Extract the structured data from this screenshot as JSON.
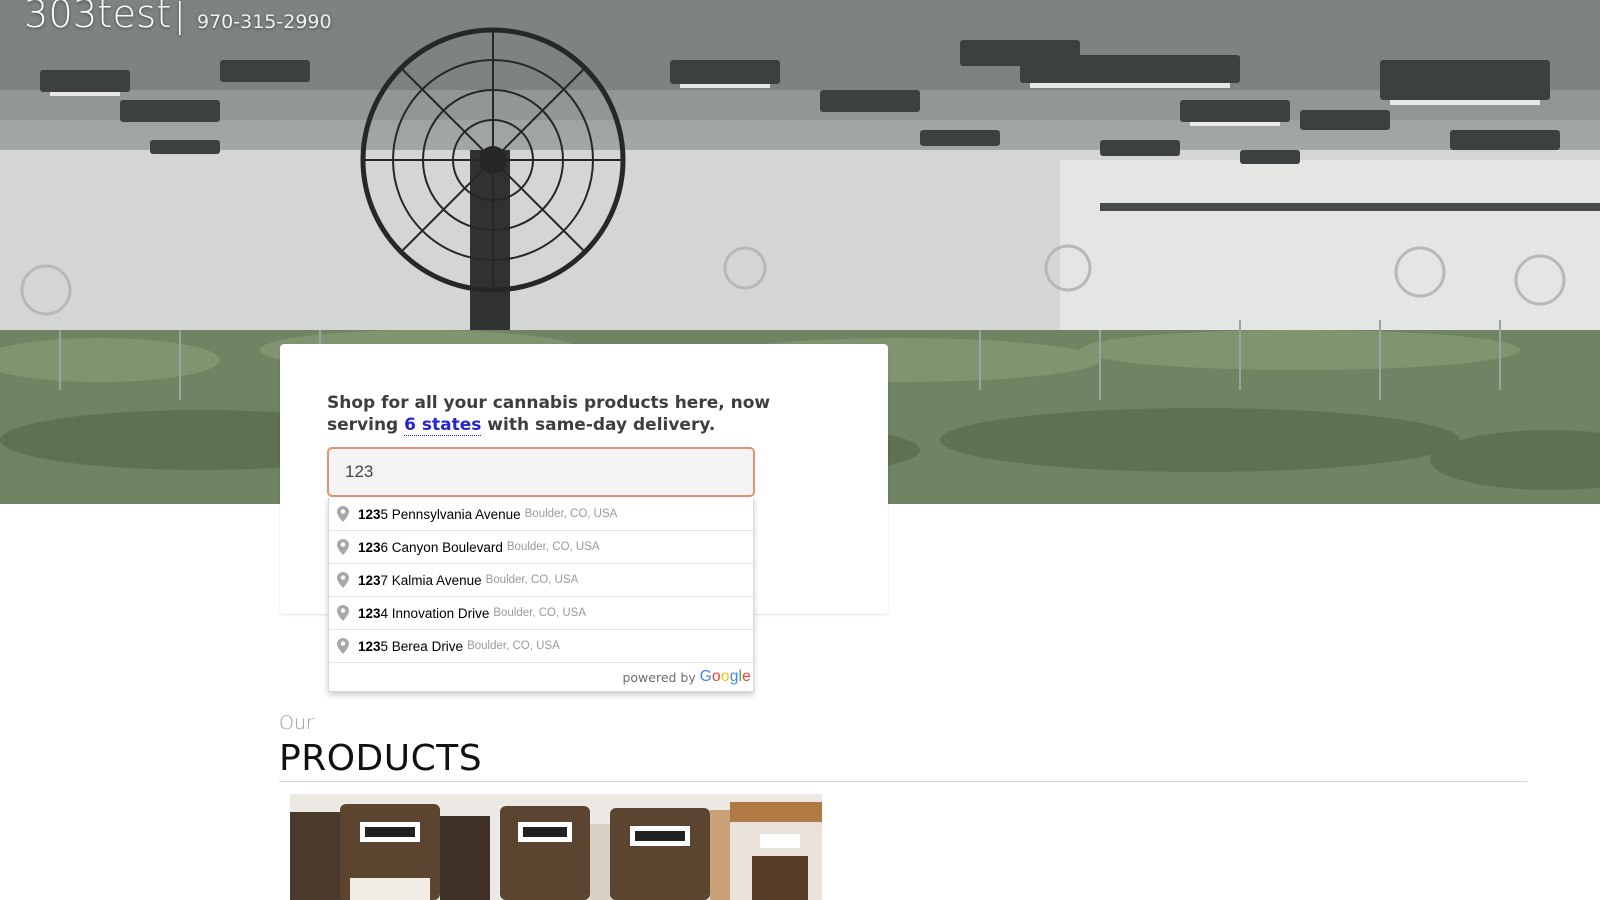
{
  "header": {
    "brand": "303test",
    "separator": "|",
    "phone": "970-315-2990"
  },
  "hero": {
    "image": "cannabis grow room with hanging lights and large fan"
  },
  "search": {
    "tagline_before": "Shop for all your cannabis products here, now serving ",
    "tagline_link": "6 states",
    "tagline_after": " with same-day delivery.",
    "input_value": "123",
    "suggestions": [
      {
        "match": "123",
        "rest": "5 Pennsylvania Avenue",
        "secondary": "Boulder, CO, USA"
      },
      {
        "match": "123",
        "rest": "6 Canyon Boulevard",
        "secondary": "Boulder, CO, USA"
      },
      {
        "match": "123",
        "rest": "7 Kalmia Avenue",
        "secondary": "Boulder, CO, USA"
      },
      {
        "match": "123",
        "rest": "4 Innovation Drive",
        "secondary": "Boulder, CO, USA"
      },
      {
        "match": "123",
        "rest": "5 Berea Drive",
        "secondary": "Boulder, CO, USA"
      }
    ],
    "powered_by": "powered by",
    "google": [
      "G",
      "o",
      "o",
      "g",
      "l",
      "e"
    ]
  },
  "products": {
    "kicker": "Our",
    "title": "PRODUCTS"
  },
  "colors": {
    "link": "#2424d4",
    "input_border": "#e69272",
    "secondary_text": "#999999"
  }
}
